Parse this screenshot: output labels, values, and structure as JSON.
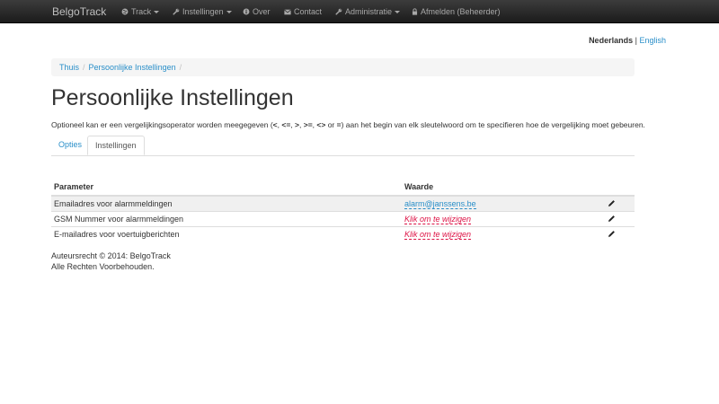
{
  "navbar": {
    "brand": "BelgoTrack",
    "items": [
      {
        "label": "Track",
        "icon": "globe-icon",
        "dropdown": true
      },
      {
        "label": "Instellingen",
        "icon": "wrench-icon",
        "dropdown": true
      },
      {
        "label": "Over",
        "icon": "info-icon",
        "dropdown": false
      },
      {
        "label": "Contact",
        "icon": "envelope-icon",
        "dropdown": false
      },
      {
        "label": "Administratie",
        "icon": "wrench-icon",
        "dropdown": true
      },
      {
        "label": "Afmelden (Beheerder)",
        "icon": "lock-icon",
        "dropdown": false
      }
    ]
  },
  "language": {
    "active": "Nederlands",
    "separator": "|",
    "other": "English"
  },
  "breadcrumb": {
    "items": [
      "Thuis",
      "Persoonlijke Instellingen"
    ],
    "separator": "/"
  },
  "page": {
    "title": "Persoonlijke Instellingen",
    "intro_prefix": "Optioneel kan er een vergelijkingsoperator worden meegegeven (",
    "operators": [
      "<",
      "<=",
      ">",
      ">=",
      "<>",
      "="
    ],
    "operator_separator": ", ",
    "intro_or": " or ",
    "intro_suffix": ") aan het begin van elk sleutelwoord om te specifieren hoe de vergelijking moet gebeuren."
  },
  "tabs": {
    "opties": "Opties",
    "instellingen": "Instellingen",
    "active": "Instellingen"
  },
  "table": {
    "headers": {
      "parameter": "Parameter",
      "value": "Waarde"
    },
    "rows": [
      {
        "parameter": "Emailadres voor alarmmeldingen",
        "value": "alarm@janssens.be",
        "empty": false
      },
      {
        "parameter": "GSM Nummer voor alarmmeldingen",
        "value": "Klik om te wijzigen",
        "empty": true
      },
      {
        "parameter": "E-mailadres voor voertuigberichten",
        "value": "Klik om te wijzigen",
        "empty": true
      }
    ],
    "edit_icon": "pencil-icon"
  },
  "footer": {
    "line1": "Auteursrecht © 2014: BelgoTrack",
    "line2": "Alle Rechten Voorbehouden."
  },
  "colors": {
    "link": "#2a8fc9",
    "empty_value": "#dd1144",
    "navbar": "#222222"
  }
}
